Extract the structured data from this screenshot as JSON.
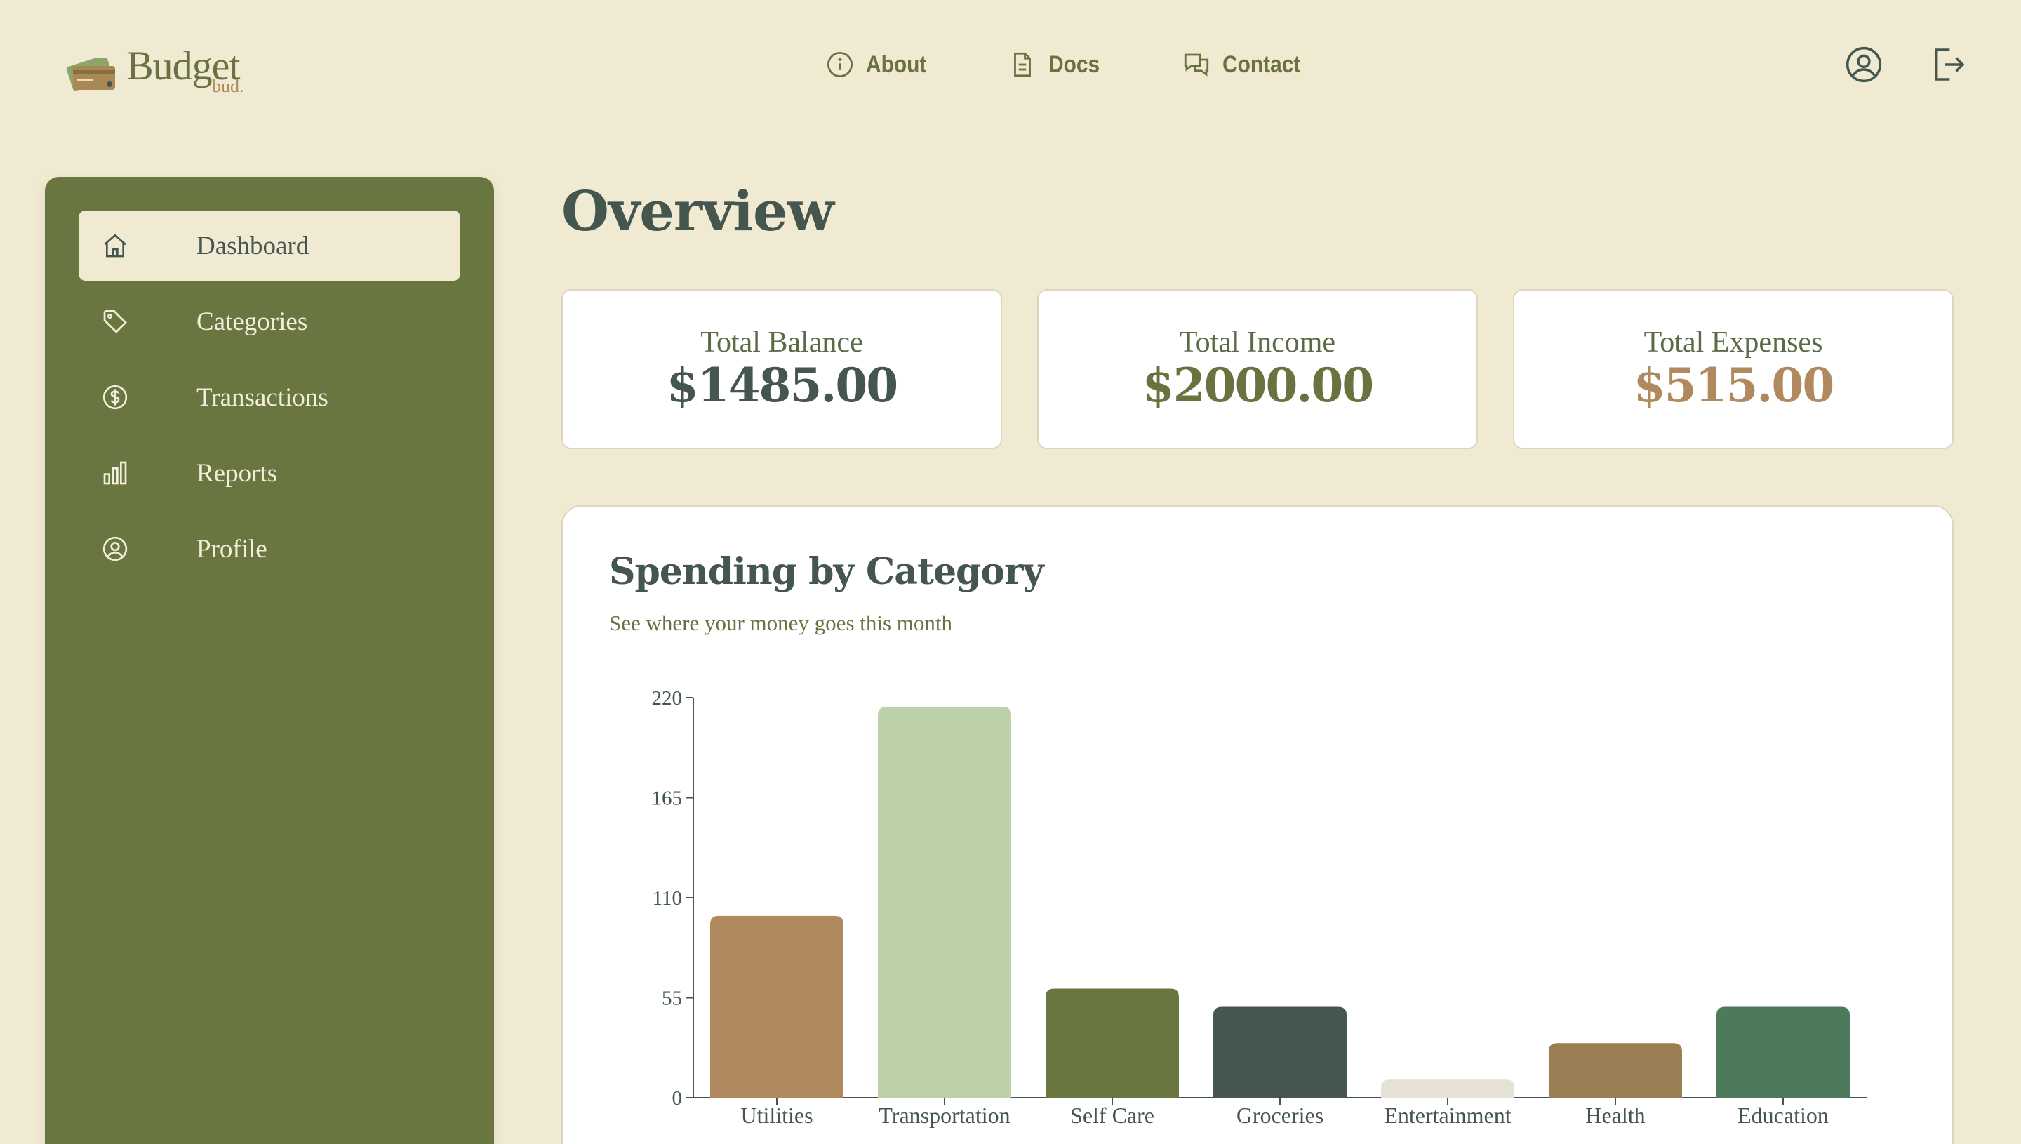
{
  "app": {
    "logo_text": "Budget",
    "logo_sub": "bud."
  },
  "nav": {
    "about": "About",
    "docs": "Docs",
    "contact": "Contact"
  },
  "sidebar": {
    "items": [
      {
        "label": "Dashboard",
        "icon": "home-icon",
        "active": true
      },
      {
        "label": "Categories",
        "icon": "tag-icon",
        "active": false
      },
      {
        "label": "Transactions",
        "icon": "dollar-circle-icon",
        "active": false
      },
      {
        "label": "Reports",
        "icon": "bar-chart-icon",
        "active": false
      },
      {
        "label": "Profile",
        "icon": "user-circle-icon",
        "active": false
      }
    ]
  },
  "main": {
    "title": "Overview",
    "stats": [
      {
        "label": "Total Balance",
        "value": "$1485.00",
        "color": "#45564f"
      },
      {
        "label": "Total Income",
        "value": "$2000.00",
        "color": "#6a7340"
      },
      {
        "label": "Total Expenses",
        "value": "$515.00",
        "color": "#b08a5e"
      }
    ],
    "chart_card": {
      "title": "Spending by Category",
      "subtitle": "See where your money goes this month"
    }
  },
  "colors": {
    "background": "#f1ead3",
    "sidebar": "#6a7640",
    "text_dark": "#45564f",
    "accent_olive": "#6a7340",
    "accent_tan": "#b08a5e"
  },
  "chart_data": {
    "type": "bar",
    "categories": [
      "Utilities",
      "Transportation",
      "Self Care",
      "Groceries",
      "Entertainment",
      "Health",
      "Education"
    ],
    "values": [
      100,
      215,
      60,
      50,
      10,
      30,
      50
    ],
    "colors": [
      "#b08a5e",
      "#bcd1aa",
      "#6a7640",
      "#45564f",
      "#e6e2d6",
      "#9a7d52",
      "#4c7a5a"
    ],
    "yticks": [
      0,
      55,
      110,
      165,
      220
    ],
    "ylim": [
      0,
      220
    ],
    "title": "Spending by Category",
    "xlabel": "",
    "ylabel": ""
  }
}
